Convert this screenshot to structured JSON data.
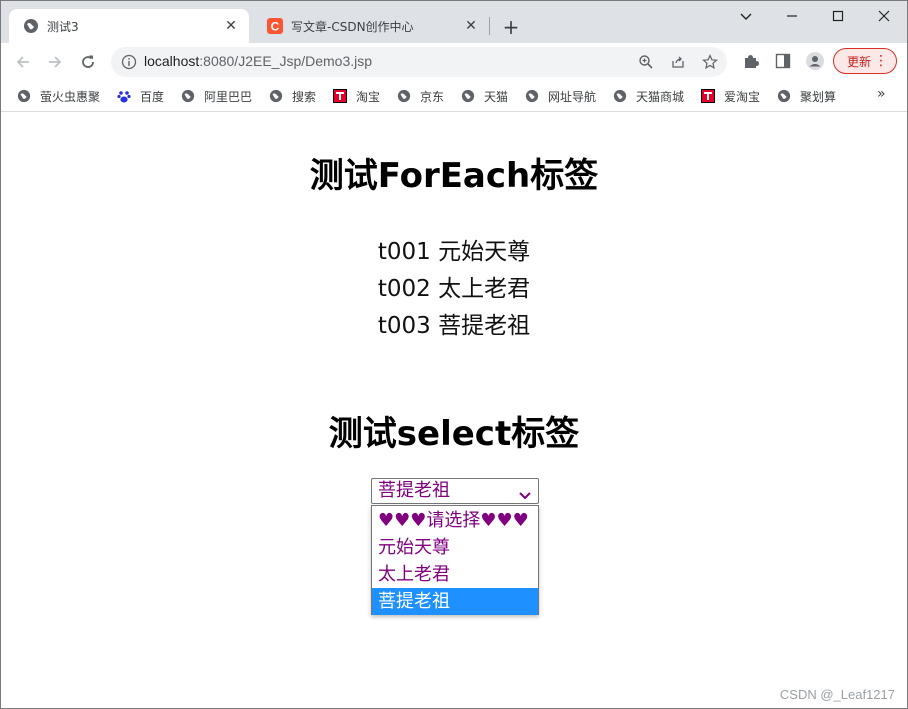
{
  "window": {
    "controls": {
      "minimize": "⌄",
      "restore": "—",
      "maximize": "☐",
      "close": "✕"
    }
  },
  "tabs": [
    {
      "title": "测试3",
      "active": true,
      "favicon": "globe-icon"
    },
    {
      "title": "写文章-CSDN创作中心",
      "active": false,
      "favicon": "csdn-c-icon"
    }
  ],
  "new_tab_label": "+",
  "address_bar": {
    "url_host": "localhost",
    "url_rest": ":8080/J2EE_Jsp/Demo3.jsp"
  },
  "update_button": {
    "label": "更新",
    "menu": "⋮"
  },
  "bookmarks": {
    "items": [
      {
        "label": "萤火虫惠聚",
        "icon": "globe-icon"
      },
      {
        "label": "百度",
        "icon": "baidu-paw-icon"
      },
      {
        "label": "阿里巴巴",
        "icon": "globe-icon"
      },
      {
        "label": "搜索",
        "icon": "globe-icon"
      },
      {
        "label": "淘宝",
        "icon": "tmall-t-icon"
      },
      {
        "label": "京东",
        "icon": "globe-icon"
      },
      {
        "label": "天猫",
        "icon": "globe-icon"
      },
      {
        "label": "网址导航",
        "icon": "globe-icon"
      },
      {
        "label": "天猫商城",
        "icon": "globe-icon"
      },
      {
        "label": "爱淘宝",
        "icon": "tmall-t-icon"
      },
      {
        "label": "聚划算",
        "icon": "globe-icon"
      }
    ],
    "more": "»"
  },
  "page": {
    "foreach_title": "测试ForEach标签",
    "rows": [
      {
        "id": "t001",
        "name": "元始天尊"
      },
      {
        "id": "t002",
        "name": "太上老君"
      },
      {
        "id": "t003",
        "name": "菩提老祖"
      }
    ],
    "select_title": "测试select标签",
    "select": {
      "value": "菩提老祖",
      "options": [
        "♥♥♥请选择♥♥♥",
        "元始天尊",
        "太上老君",
        "菩提老祖"
      ],
      "highlighted_index": 3,
      "text_color": "#800080",
      "highlight_color": "#1e90ff"
    }
  },
  "watermark": "CSDN @_Leaf1217"
}
